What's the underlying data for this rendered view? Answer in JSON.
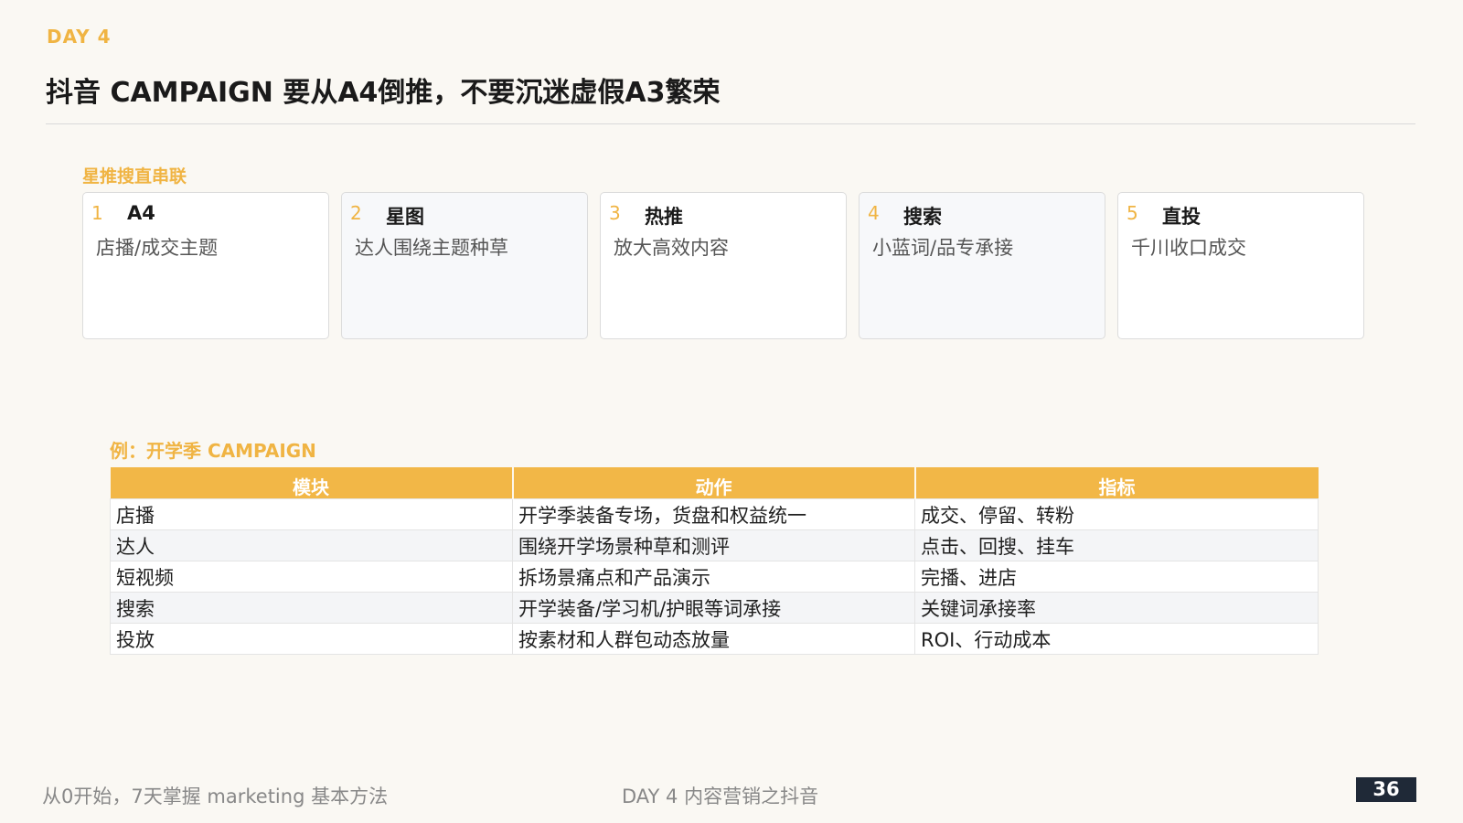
{
  "header": {
    "day_label": "DAY 4",
    "title": "抖音 CAMPAIGN 要从A4倒推，不要沉迷虚假A3繁荣"
  },
  "steps_section": {
    "label": "星推搜直串联",
    "steps": [
      {
        "num": "1",
        "title": "A4",
        "desc": "店播/成交主题"
      },
      {
        "num": "2",
        "title": "星图",
        "desc": "达人围绕主题种草"
      },
      {
        "num": "3",
        "title": "热推",
        "desc": "放大高效内容"
      },
      {
        "num": "4",
        "title": "搜索",
        "desc": "小蓝词/品专承接"
      },
      {
        "num": "5",
        "title": "直投",
        "desc": "千川收口成交"
      }
    ]
  },
  "example": {
    "label": "例：开学季 CAMPAIGN",
    "headers": [
      "模块",
      "动作",
      "指标"
    ],
    "rows": [
      [
        "店播",
        "开学季装备专场，货盘和权益统一",
        "成交、停留、转粉"
      ],
      [
        "达人",
        "围绕开学场景种草和测评",
        "点击、回搜、挂车"
      ],
      [
        "短视频",
        "拆场景痛点和产品演示",
        "完播、进店"
      ],
      [
        "搜索",
        "开学装备/学习机/护眼等词承接",
        "关键词承接率"
      ],
      [
        "投放",
        "按素材和人群包动态放量",
        "ROI、行动成本"
      ]
    ]
  },
  "footer": {
    "left": "从0开始，7天掌握 marketing 基本方法",
    "center": "DAY 4 内容营销之抖音",
    "page_number": "36"
  },
  "colors": {
    "accent": "#f0b443",
    "table_header": "#f2b747",
    "page_badge": "#1f2937"
  }
}
